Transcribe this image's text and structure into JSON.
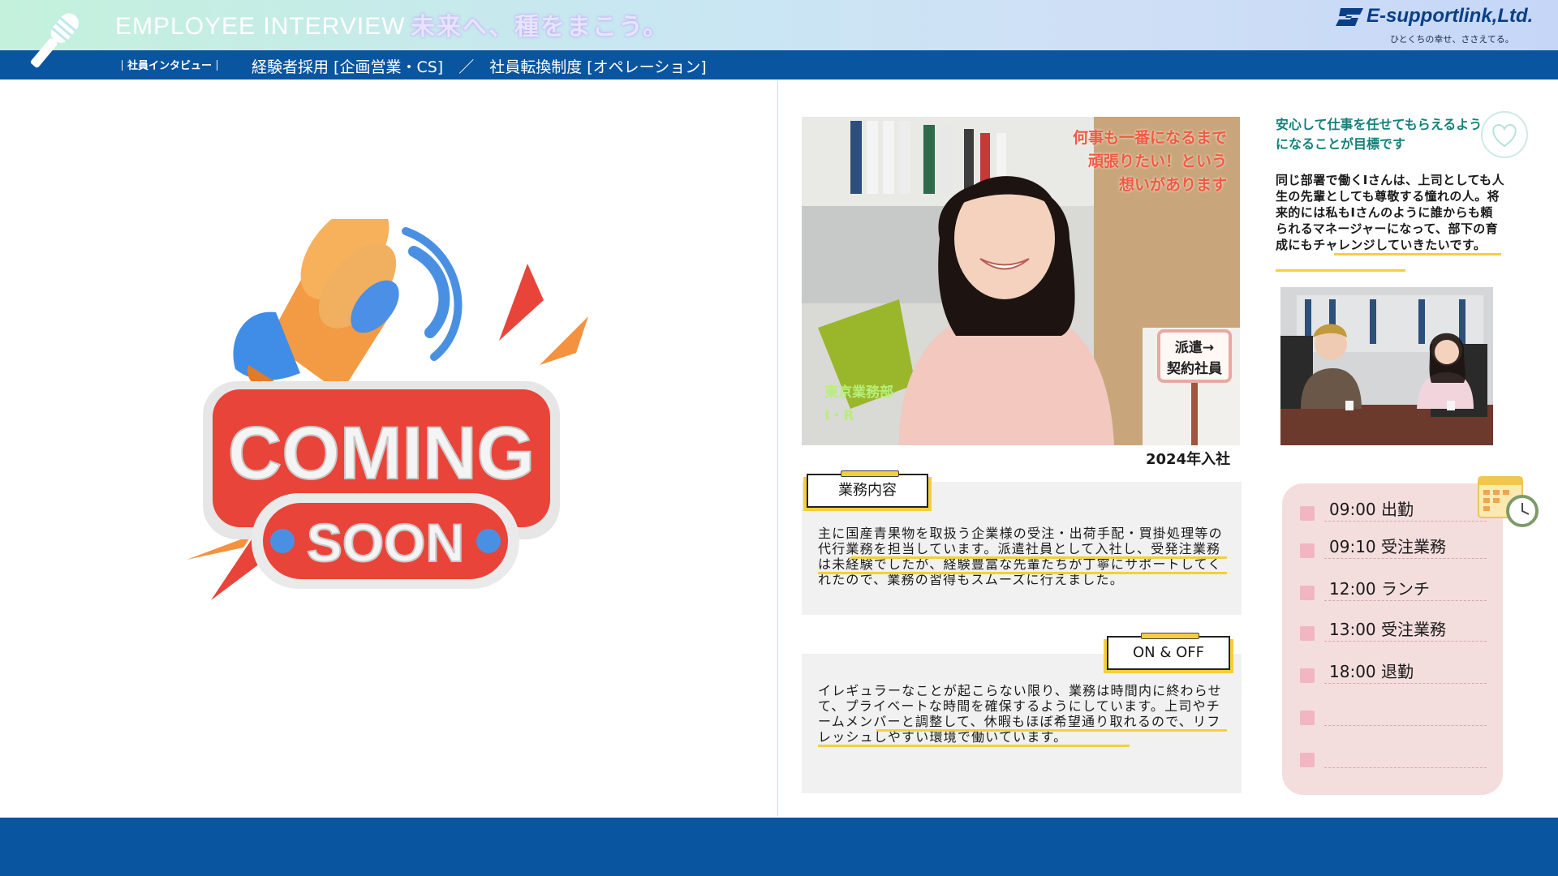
{
  "header": {
    "title": "EMPLOYEE INTERVIEW",
    "catchphrase": "未来へ、種をまこう。",
    "logo": "E-supportlink,Ltd.",
    "logo_tagline": "ひとくちの幸せ、ささえてる。",
    "bar_label": "社員インタビュー",
    "bar_text": "経験者採用 [企画営業・CS]　／　社員転換制度 [オペレーション]"
  },
  "left_panel": {
    "coming_soon_line1": "COMING",
    "coming_soon_line2": "SOON"
  },
  "profile": {
    "photo_caption": [
      "何事も一番になるまで",
      "頑張りたい！という",
      "想いがあります"
    ],
    "department": "東京業務部",
    "initials": "I・R",
    "sign_line1": "派遣→",
    "sign_line2": "契約社員",
    "join_year": "2024年入社"
  },
  "work": {
    "tag": "業務内容",
    "text": "主に国産青果物を取扱う企業様の受注・出荷手配・買掛処理等の代行業務を担当しています。派遣社員として入社し、受発注業務は未経験でしたが、経験豊富な先輩たちが丁寧にサポートしてくれたので、業務の習得もスムーズに行えました。"
  },
  "on_off": {
    "tag": "ON & OFF",
    "text": "イレギュラーなことが起こらない限り、業務は時間内に終わらせて、プライベートな時間を確保するようにしています。上司やチームメンバーと調整して、休暇もほぼ希望通り取れるので、リフレッシュしやすい環境で働いています。"
  },
  "goal": {
    "title": "安心して仕事を任せてもらえるようになることが目標です",
    "text": "同じ部署で働くIさんは、上司としても人生の先輩としても尊敬する憧れの人。将来的には私もIさんのように誰からも頼られるマネージャーになって、部下の育成にもチャレンジしていきたいです。"
  },
  "schedule": {
    "items": [
      "09:00 出勤",
      "09:10 受注業務",
      "12:00 ランチ",
      "13:00 受注業務",
      "18:00 退勤",
      "",
      ""
    ]
  },
  "colors": {
    "brand_blue": "#0a55a0",
    "accent_yellow": "#f6cf3a",
    "caption_red": "#f05a41",
    "teal": "#15807a",
    "schedule_bg": "#f4dddd"
  }
}
